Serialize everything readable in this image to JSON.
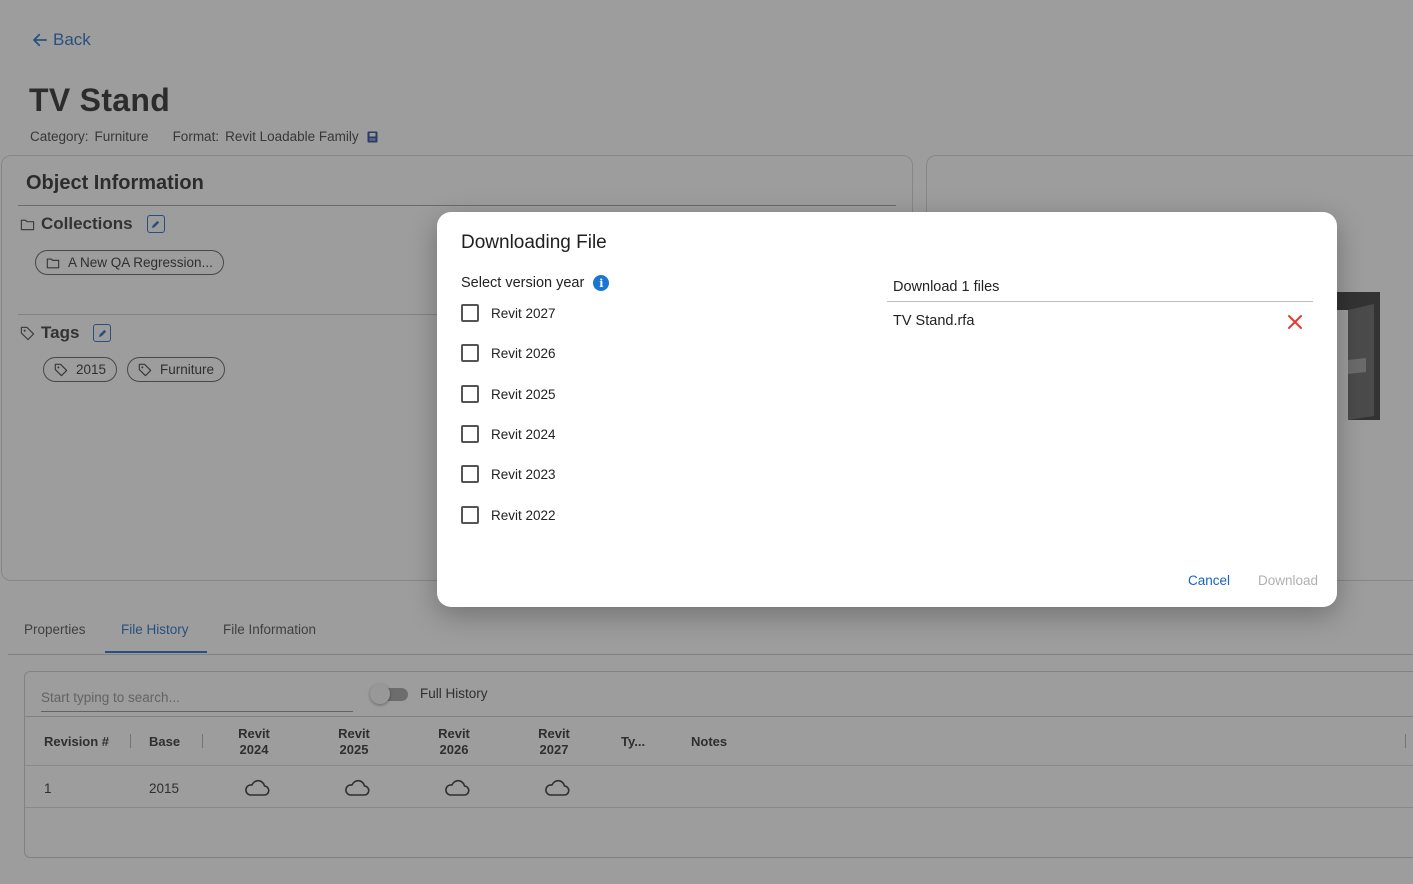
{
  "page": {
    "back_label": "Back",
    "title": "TV Stand",
    "category_label": "Category:",
    "category_value": "Furniture",
    "format_label": "Format:",
    "format_value": "Revit Loadable Family"
  },
  "object_info": {
    "title": "Object Information",
    "collections_title": "Collections",
    "collections": [
      "A New QA Regression..."
    ],
    "tags_title": "Tags",
    "tags": [
      "2015",
      "Furniture"
    ]
  },
  "tabs": [
    {
      "label": "Properties",
      "active": false
    },
    {
      "label": "File History",
      "active": true
    },
    {
      "label": "File Information",
      "active": false
    }
  ],
  "history": {
    "search_placeholder": "Start typing to search...",
    "toggle_label": "Full History",
    "toggle_on": false,
    "columns": [
      "Revision #",
      "Base",
      "Revit 2024",
      "Revit 2025",
      "Revit 2026",
      "Revit 2027",
      "Ty...",
      "Notes"
    ],
    "rows": [
      {
        "revision": "1",
        "base": "2015",
        "revit_2024": "cloud-icon",
        "revit_2025": "cloud-icon",
        "revit_2026": "cloud-icon",
        "revit_2027": "cloud-icon",
        "type": "",
        "notes": ""
      }
    ]
  },
  "modal": {
    "title": "Downloading File",
    "version_label": "Select version year",
    "versions": [
      {
        "label": "Revit 2027",
        "checked": false
      },
      {
        "label": "Revit 2026",
        "checked": false
      },
      {
        "label": "Revit 2025",
        "checked": false
      },
      {
        "label": "Revit 2024",
        "checked": false
      },
      {
        "label": "Revit 2023",
        "checked": false
      },
      {
        "label": "Revit 2022",
        "checked": false
      }
    ],
    "download_header": "Download 1 files",
    "files": [
      "TV Stand.rfa"
    ],
    "cancel_label": "Cancel",
    "download_label": "Download",
    "download_enabled": false
  },
  "colors": {
    "accent": "#1565c0",
    "info": "#1976d2",
    "remove": "#e53935",
    "disabled": "#b0b0b0"
  }
}
